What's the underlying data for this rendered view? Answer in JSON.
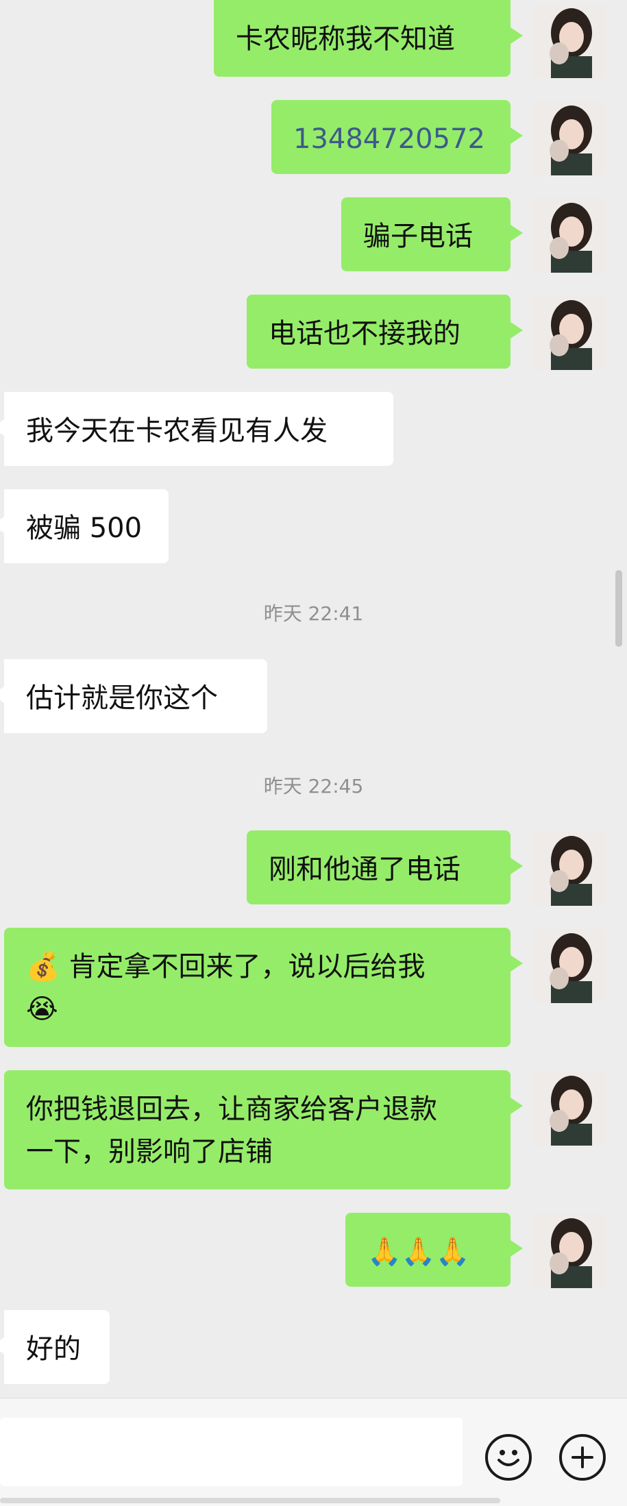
{
  "messages": [
    {
      "side": "out",
      "text": "卡农昵称我不知道"
    },
    {
      "side": "out",
      "text": "13484720572"
    },
    {
      "side": "out",
      "text": "骗子电话"
    },
    {
      "side": "out",
      "text": "电话也不接我的"
    },
    {
      "side": "in",
      "text": "我今天在卡农看见有人发"
    },
    {
      "side": "in",
      "text": "被骗 500"
    },
    {
      "side": "in",
      "text": "估计就是你这个"
    },
    {
      "side": "out",
      "text": "刚和他通了电话"
    },
    {
      "side": "out",
      "text": "💰 肯定拿不回来了，说以后给我\n😭"
    },
    {
      "side": "out",
      "text": "你把钱退回去，让商家给客户退款\n一下，别影响了店铺"
    },
    {
      "side": "out",
      "text": "🙏🙏🙏"
    },
    {
      "side": "in",
      "text": "好的"
    }
  ],
  "timestamps": [
    "昨天 22:41",
    "昨天 22:45"
  ],
  "input": {
    "placeholder": "",
    "emoji_icon": "smiley-icon",
    "plus_icon": "plus-icon"
  },
  "colors": {
    "outgoing_bubble": "#95ec69",
    "incoming_bubble": "#ffffff",
    "background": "#ededed"
  }
}
